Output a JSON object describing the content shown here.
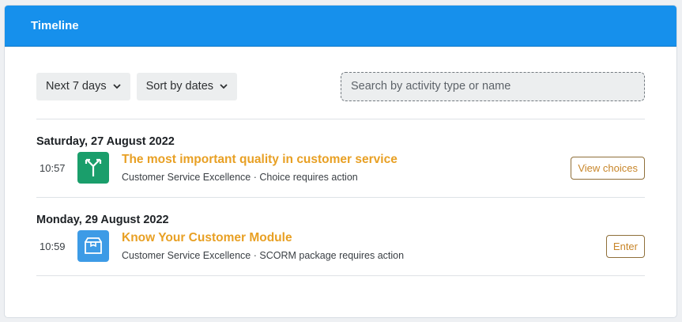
{
  "header": {
    "title": "Timeline"
  },
  "filters": {
    "range_label": "Next 7 days",
    "sort_label": "Sort by dates"
  },
  "search": {
    "placeholder": "Search by activity type or name",
    "value": ""
  },
  "days": [
    {
      "date": "Saturday, 27 August 2022",
      "events": [
        {
          "time": "10:57",
          "icon": "choice-icon",
          "icon_color": "#1a9e6b",
          "name": "The most important quality in customer service",
          "meta": "Customer Service Excellence · Choice requires action",
          "action": "View choices"
        }
      ]
    },
    {
      "date": "Monday, 29 August 2022",
      "events": [
        {
          "time": "10:59",
          "icon": "scorm-package-icon",
          "icon_color": "#3d9be6",
          "name": "Know Your Customer Module",
          "meta": "Customer Service Excellence · SCORM package requires action",
          "action": "Enter"
        }
      ]
    }
  ],
  "colors": {
    "header_bg": "#1690ec",
    "link": "#e8a024"
  }
}
